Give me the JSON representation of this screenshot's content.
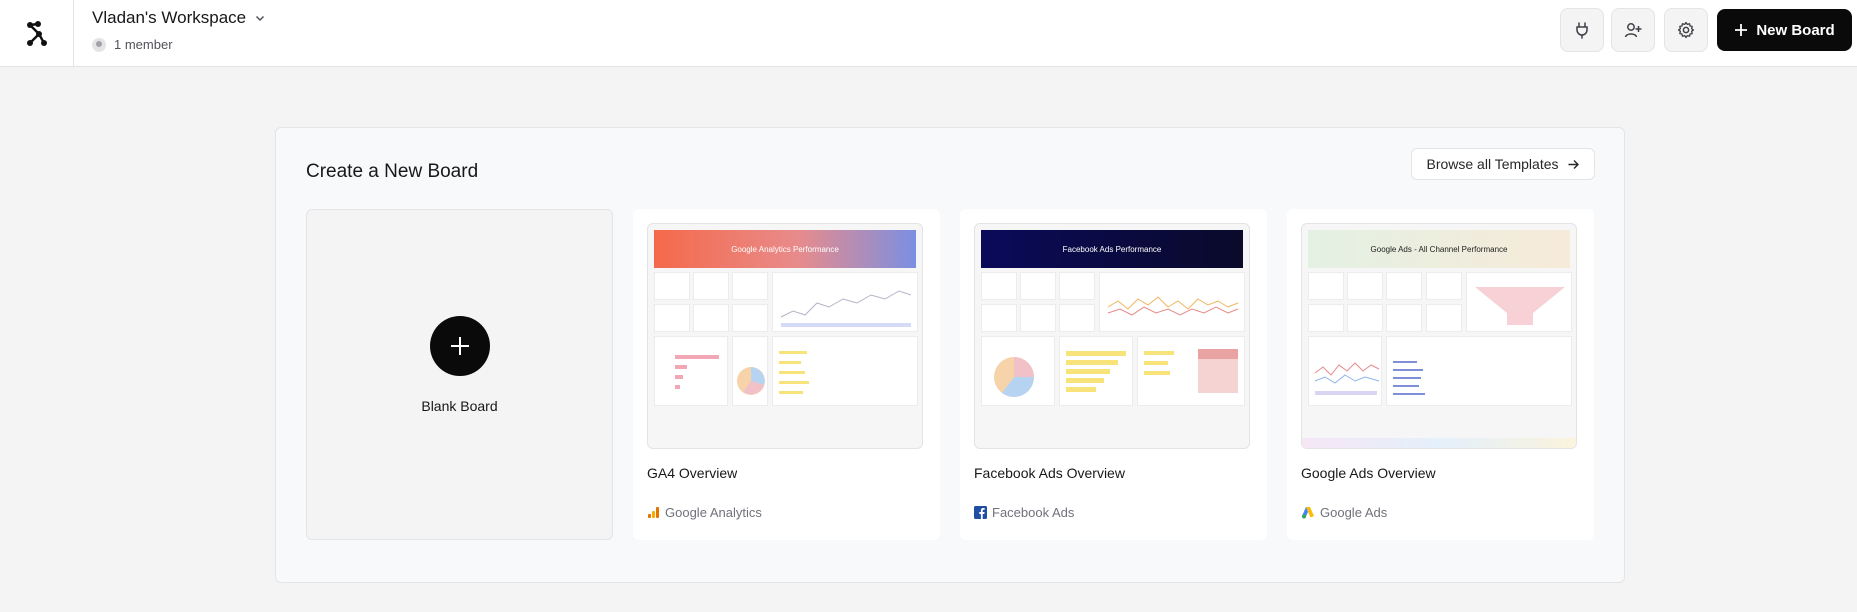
{
  "header": {
    "workspace_name": "Vladan's Workspace",
    "member_count": "1 member",
    "new_board_label": "New Board"
  },
  "main": {
    "title": "Create a New Board",
    "browse_label": "Browse all Templates",
    "blank_label": "Blank Board",
    "templates": [
      {
        "title": "GA4 Overview",
        "source": "Google Analytics",
        "preview_heading": "Google Analytics Performance",
        "accent": "#f28b5b"
      },
      {
        "title": "Facebook Ads Overview",
        "source": "Facebook Ads",
        "preview_heading": "Facebook Ads Performance",
        "accent": "#0b0b5c"
      },
      {
        "title": "Google Ads Overview",
        "source": "Google Ads",
        "preview_heading": "Google Ads - All Channel Performance",
        "accent": "#e8f2e4"
      }
    ]
  },
  "icons": [
    "app-logo-icon",
    "chevron-down-icon",
    "plug-icon",
    "add-user-icon",
    "gear-icon",
    "plus-icon",
    "arrow-right-icon",
    "google-analytics-icon",
    "facebook-icon",
    "google-ads-icon"
  ]
}
